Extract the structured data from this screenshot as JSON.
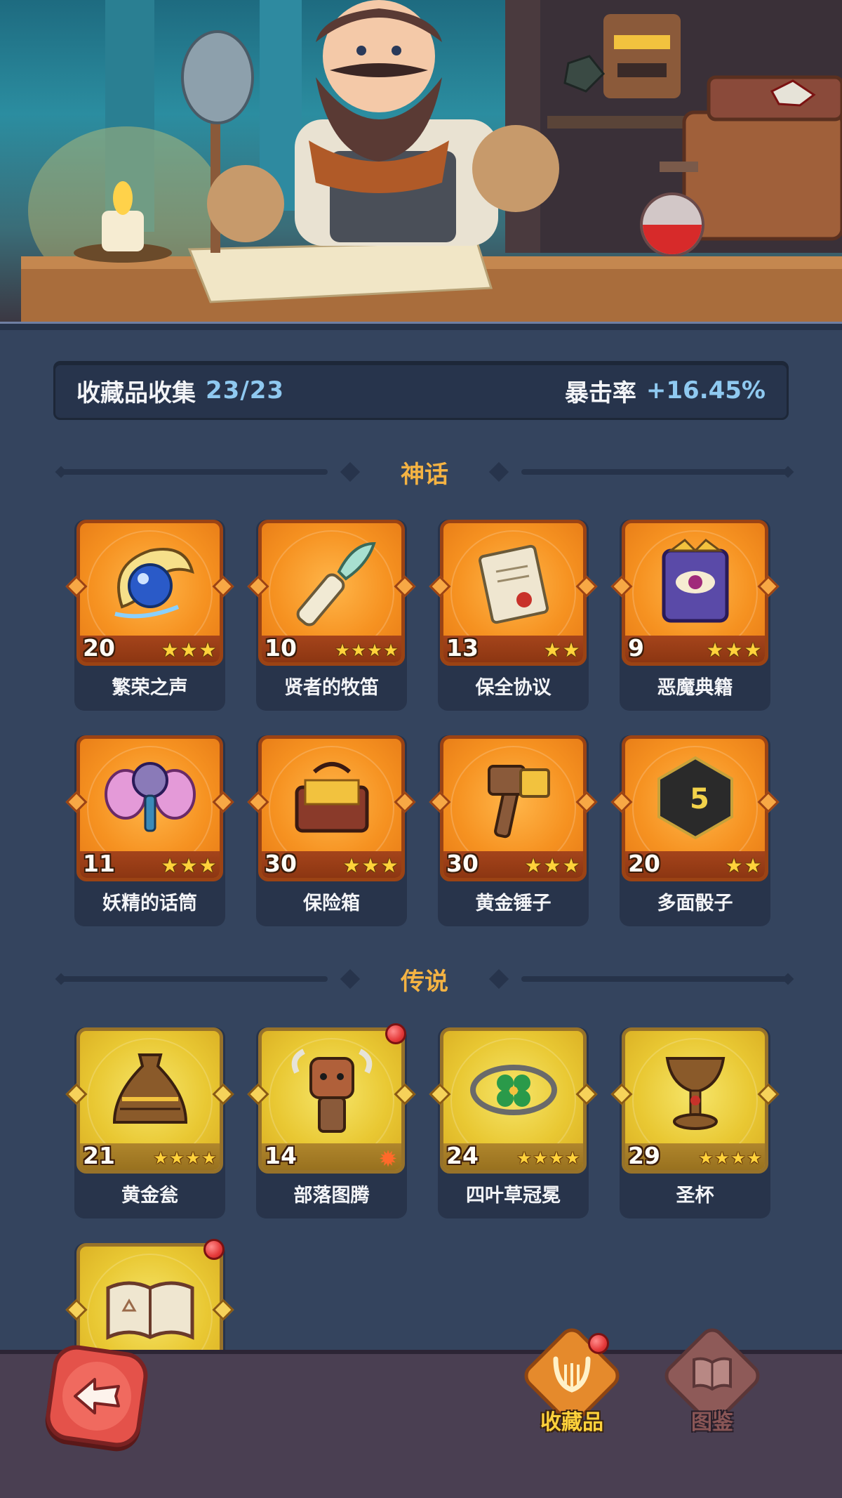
{
  "stats": {
    "collection_label": "收藏品收集",
    "collection_count": "23/23",
    "crit_label": "暴击率",
    "crit_value": "+16.45%"
  },
  "sections": {
    "mythic": {
      "title": "神话"
    },
    "legend": {
      "title": "传说"
    }
  },
  "mythic_items": [
    {
      "name": "繁荣之声",
      "level": "20",
      "stars": 3,
      "icon": "cloud-orb-icon"
    },
    {
      "name": "贤者的牧笛",
      "level": "10",
      "stars": 4,
      "icon": "flute-icon"
    },
    {
      "name": "保全协议",
      "level": "13",
      "stars": 2,
      "icon": "scroll-icon"
    },
    {
      "name": "恶魔典籍",
      "level": "9",
      "stars": 3,
      "icon": "demon-book-icon"
    },
    {
      "name": "妖精的话筒",
      "level": "11",
      "stars": 3,
      "icon": "fairy-mic-icon"
    },
    {
      "name": "保险箱",
      "level": "30",
      "stars": 3,
      "icon": "treasure-chest-icon"
    },
    {
      "name": "黄金锤子",
      "level": "30",
      "stars": 3,
      "icon": "golden-hammer-icon"
    },
    {
      "name": "多面骰子",
      "level": "20",
      "stars": 2,
      "icon": "dice-icon"
    }
  ],
  "legend_items": [
    {
      "name": "黄金瓮",
      "level": "21",
      "stars": 4,
      "icon": "golden-urn-icon"
    },
    {
      "name": "部落图腾",
      "level": "14",
      "stars": 0,
      "icon": "tribal-totem-icon"
    },
    {
      "name": "四叶草冠冕",
      "level": "24",
      "stars": 4,
      "icon": "clover-crown-icon"
    },
    {
      "name": "圣杯",
      "level": "29",
      "stars": 4,
      "icon": "grail-icon"
    },
    {
      "name": "",
      "level": "",
      "stars": 0,
      "icon": "spell-book-icon"
    }
  ],
  "tabs": {
    "collectibles": "收藏品",
    "codex": "图鉴"
  },
  "colors": {
    "background": "#34445e",
    "mythic_tile": "#f69221",
    "legend_tile": "#e9c833",
    "accent_gold": "#f4b343",
    "accent_blue": "#8fc9f0"
  }
}
